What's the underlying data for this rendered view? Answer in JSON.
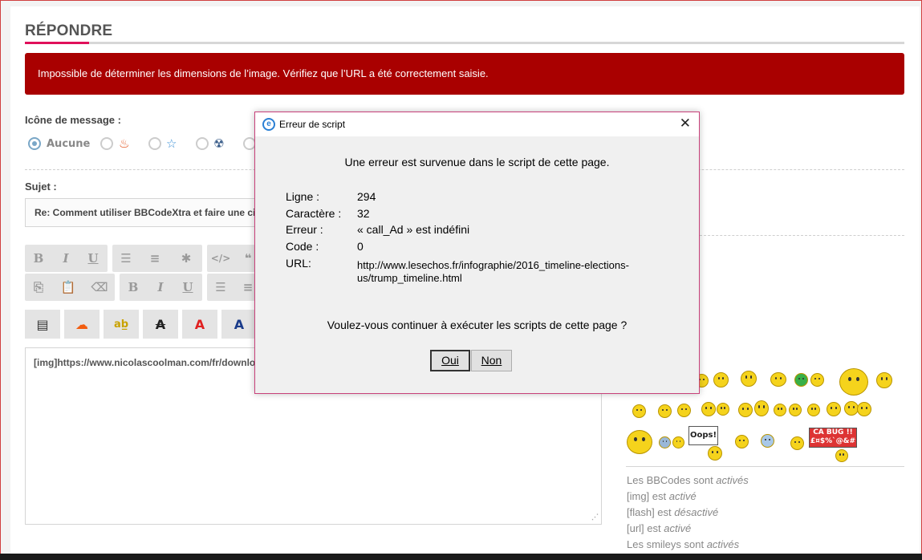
{
  "section": {
    "title": "RÉPONDRE"
  },
  "alert": {
    "message": "Impossible de déterminer les dimensions de l’image. Vérifiez que l’URL a été correctement saisie."
  },
  "message_icon": {
    "label": "Icône de message :",
    "options": [
      {
        "label": "Aucune",
        "selected": true
      },
      {
        "icon": "fire-icon"
      },
      {
        "icon": "star-icon"
      },
      {
        "icon": "radiation-icon"
      }
    ]
  },
  "subject": {
    "label": "Sujet :",
    "value": "Re: Comment utiliser BBCodeXtra et faire une citation"
  },
  "toolbar": {
    "row1": [
      "B",
      "I",
      "U"
    ],
    "row2": [
      "B",
      "I",
      "U"
    ]
  },
  "editor": {
    "content": "[img]https://www.nicolascoolman.com/fr/downloads/"
  },
  "smileys": {
    "sign1": "Oops!",
    "sign2_line1": "CA BUG !!",
    "sign2_line2": "£¤$%`@&#"
  },
  "status": {
    "bbcodes": {
      "prefix": "Les BBCodes sont ",
      "state": "activés"
    },
    "img": {
      "prefix": "[img] est ",
      "state": "activé"
    },
    "flash": {
      "prefix": "[flash] est ",
      "state": "désactivé"
    },
    "url": {
      "prefix": "[url] est ",
      "state": "activé"
    },
    "smilies": {
      "prefix": "Les smileys sont ",
      "state": "activés"
    }
  },
  "dialog": {
    "title": "Erreur de script",
    "message": "Une erreur est survenue dans le script de cette page.",
    "line_label": "Ligne :",
    "line_value": "294",
    "char_label": "Caractère :",
    "char_value": "32",
    "error_label": "Erreur :",
    "error_value": "« call_Ad » est indéfini",
    "code_label": "Code :",
    "code_value": "0",
    "url_label": "URL:",
    "url_line1": "http://www.lesechos.fr/infographie/2016_timeline-elections-",
    "url_line2": "us/trump_timeline.html",
    "question": "Voulez-vous continuer à exécuter les scripts de cette page ?",
    "yes_label": "Oui",
    "no_label": "Non"
  },
  "colors": {
    "alert_bg": "#a90000",
    "accent": "#e0105a",
    "dialog_border": "#c8417a"
  }
}
